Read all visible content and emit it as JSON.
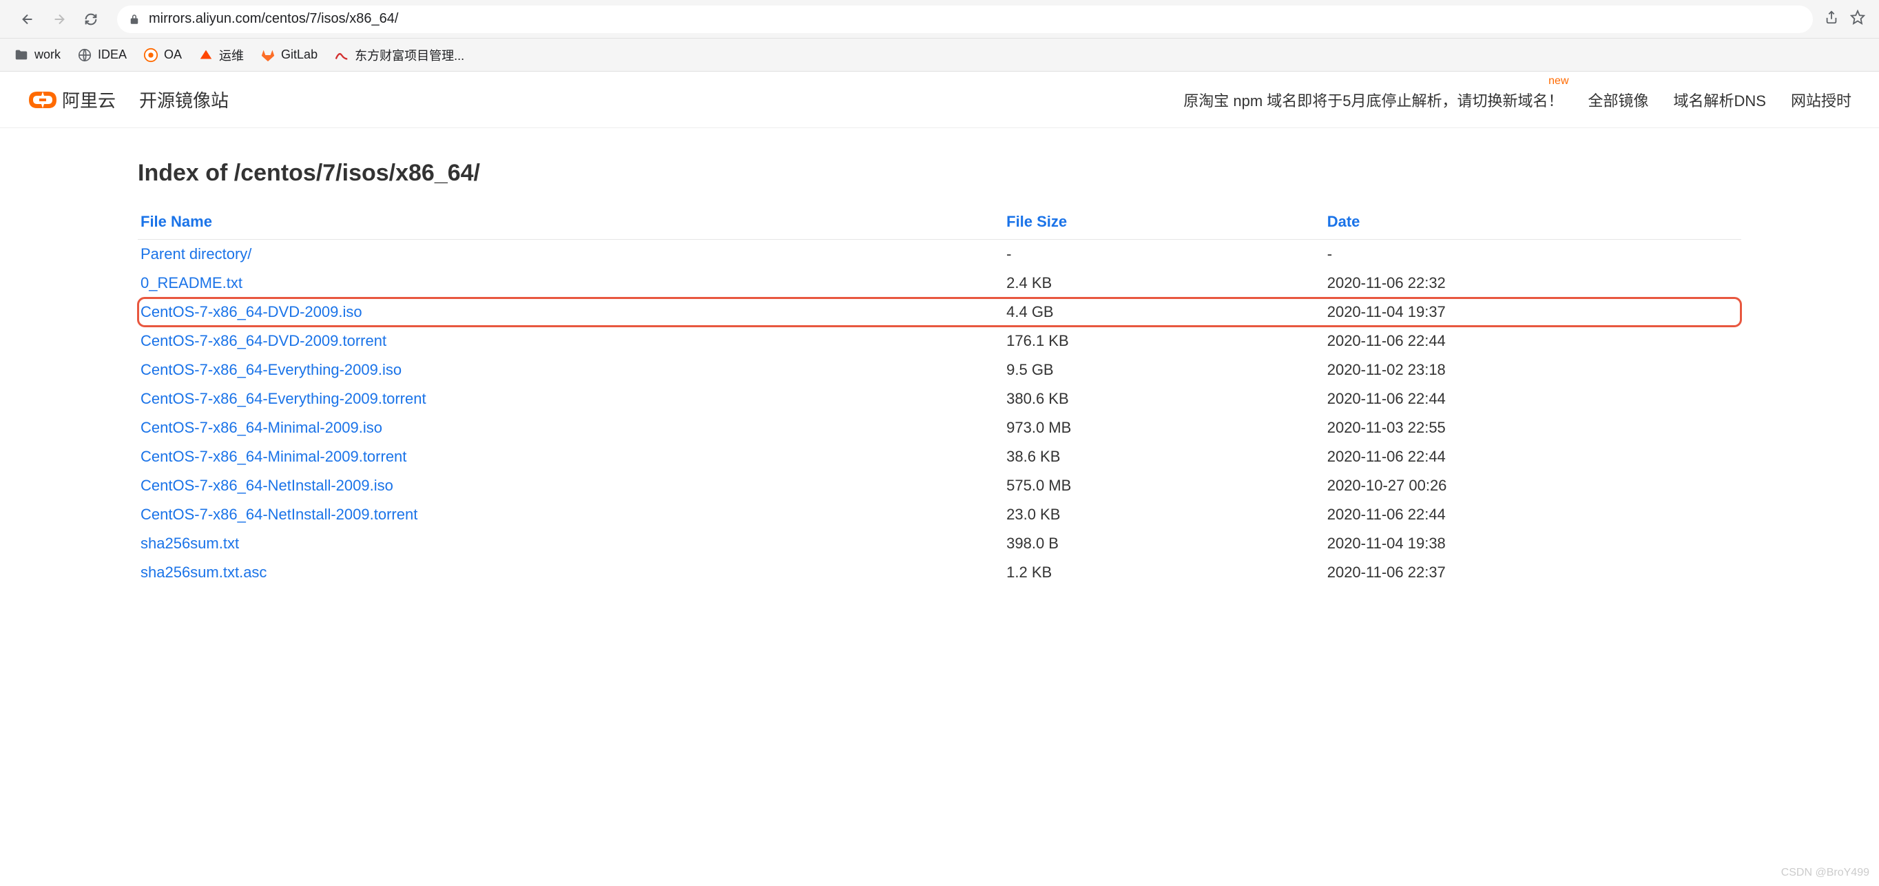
{
  "browser": {
    "url": "mirrors.aliyun.com/centos/7/isos/x86_64/"
  },
  "bookmarks": [
    {
      "label": "work",
      "icon": "folder"
    },
    {
      "label": "IDEA",
      "icon": "globe"
    },
    {
      "label": "OA",
      "icon": "oa"
    },
    {
      "label": "运维",
      "icon": "yunwei"
    },
    {
      "label": "GitLab",
      "icon": "gitlab"
    },
    {
      "label": "东方财富项目管理...",
      "icon": "dfcf"
    }
  ],
  "header": {
    "logo_text": "阿里云",
    "site_title": "开源镜像站",
    "notice": "原淘宝 npm 域名即将于5月底停止解析，请切换新域名！",
    "new_badge": "new",
    "nav": [
      "全部镜像",
      "域名解析DNS",
      "网站授时"
    ]
  },
  "page": {
    "title": "Index of /centos/7/isos/x86_64/",
    "columns": {
      "name": "File Name",
      "size": "File Size",
      "date": "Date"
    },
    "rows": [
      {
        "name": "Parent directory/",
        "size": "-",
        "date": "-",
        "highlighted": false
      },
      {
        "name": "0_README.txt",
        "size": "2.4 KB",
        "date": "2020-11-06 22:32",
        "highlighted": false
      },
      {
        "name": "CentOS-7-x86_64-DVD-2009.iso",
        "size": "4.4 GB",
        "date": "2020-11-04 19:37",
        "highlighted": true
      },
      {
        "name": "CentOS-7-x86_64-DVD-2009.torrent",
        "size": "176.1 KB",
        "date": "2020-11-06 22:44",
        "highlighted": false
      },
      {
        "name": "CentOS-7-x86_64-Everything-2009.iso",
        "size": "9.5 GB",
        "date": "2020-11-02 23:18",
        "highlighted": false
      },
      {
        "name": "CentOS-7-x86_64-Everything-2009.torrent",
        "size": "380.6 KB",
        "date": "2020-11-06 22:44",
        "highlighted": false
      },
      {
        "name": "CentOS-7-x86_64-Minimal-2009.iso",
        "size": "973.0 MB",
        "date": "2020-11-03 22:55",
        "highlighted": false
      },
      {
        "name": "CentOS-7-x86_64-Minimal-2009.torrent",
        "size": "38.6 KB",
        "date": "2020-11-06 22:44",
        "highlighted": false
      },
      {
        "name": "CentOS-7-x86_64-NetInstall-2009.iso",
        "size": "575.0 MB",
        "date": "2020-10-27 00:26",
        "highlighted": false
      },
      {
        "name": "CentOS-7-x86_64-NetInstall-2009.torrent",
        "size": "23.0 KB",
        "date": "2020-11-06 22:44",
        "highlighted": false
      },
      {
        "name": "sha256sum.txt",
        "size": "398.0 B",
        "date": "2020-11-04 19:38",
        "highlighted": false
      },
      {
        "name": "sha256sum.txt.asc",
        "size": "1.2 KB",
        "date": "2020-11-06 22:37",
        "highlighted": false
      }
    ]
  },
  "watermark": "CSDN @BroY499"
}
